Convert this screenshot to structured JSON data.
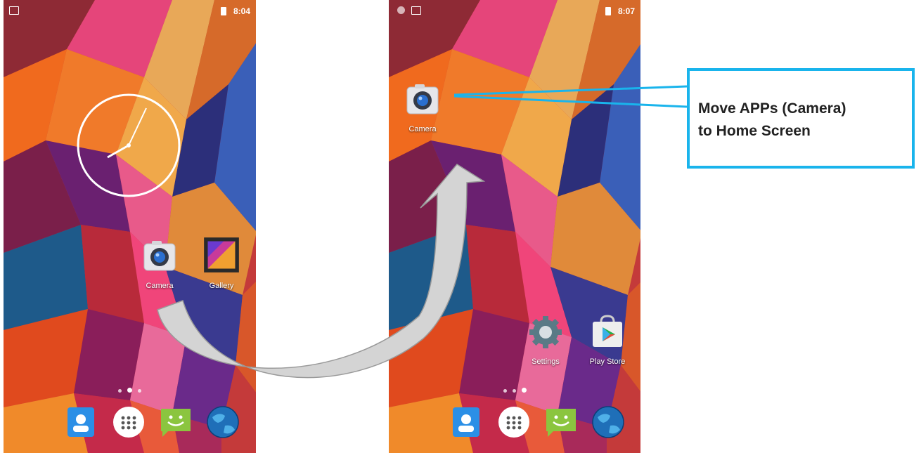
{
  "left_phone": {
    "status": {
      "time": "8:04"
    },
    "apps": [
      {
        "label": "Camera",
        "icon": "camera-icon"
      },
      {
        "label": "Gallery",
        "icon": "gallery-icon"
      }
    ],
    "clock_widget": {
      "icon": "analog-clock-icon"
    },
    "dock": [
      "contacts-icon",
      "app-drawer-icon",
      "messaging-icon",
      "browser-icon"
    ]
  },
  "right_phone": {
    "status": {
      "time": "8:07"
    },
    "apps": [
      {
        "label": "Camera",
        "icon": "camera-icon"
      },
      {
        "label": "Settings",
        "icon": "settings-gear-icon"
      },
      {
        "label": "Play Store",
        "icon": "play-store-icon"
      }
    ],
    "dock": [
      "contacts-icon",
      "app-drawer-icon",
      "messaging-icon",
      "browser-icon"
    ]
  },
  "callout": {
    "line1": "Move APPs (Camera)",
    "line2": "to Home Screen",
    "border_color": "#19b4ec"
  },
  "arrow": {
    "icon": "curved-arrow-icon",
    "color": "#d4d4d4"
  }
}
